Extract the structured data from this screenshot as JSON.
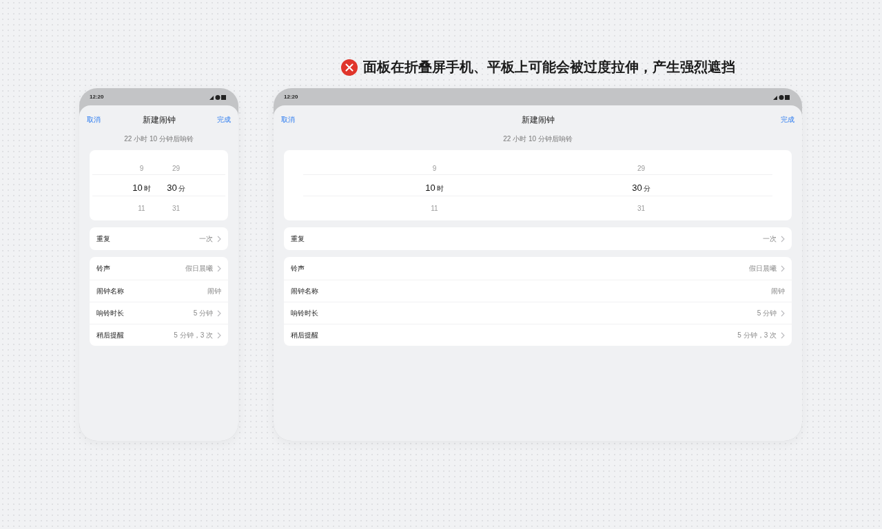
{
  "caption": {
    "text": "面板在折叠屏手机、平板上可能会被过度拉伸，产生强烈遮挡",
    "kind": "error"
  },
  "devices": [
    {
      "kind": "phone",
      "status_bar": {
        "time": "12:20"
      },
      "nav": {
        "cancel": "取消",
        "title": "新建闹钟",
        "done": "完成"
      },
      "countdown": "22 小时 10 分钟后响铃",
      "picker": [
        {
          "unit": "时",
          "items": [
            {
              "text": "9",
              "selected": false
            },
            {
              "text": "10",
              "selected": true
            },
            {
              "text": "11",
              "selected": false
            }
          ]
        },
        {
          "unit": "分",
          "items": [
            {
              "text": "29",
              "selected": false
            },
            {
              "text": "30",
              "selected": true
            },
            {
              "text": "31",
              "selected": false
            }
          ]
        }
      ],
      "groups": [
        [
          {
            "label": "重复",
            "value": "一次",
            "chevron": true
          }
        ],
        [
          {
            "label": "铃声",
            "value": "假日晨曦",
            "chevron": true
          },
          {
            "label": "闹钟名称",
            "value": "闹钟",
            "chevron": false
          },
          {
            "label": "响铃时长",
            "value": "5 分钟",
            "chevron": true
          },
          {
            "label": "稍后提醒",
            "value": "5 分钟，3 次",
            "chevron": true
          }
        ]
      ]
    },
    {
      "kind": "tablet",
      "status_bar": {
        "time": "12:20"
      },
      "nav": {
        "cancel": "取消",
        "title": "新建闹钟",
        "done": "完成"
      },
      "countdown": "22 小时 10 分钟后响铃",
      "picker": [
        {
          "unit": "时",
          "items": [
            {
              "text": "9",
              "selected": false
            },
            {
              "text": "10",
              "selected": true
            },
            {
              "text": "11",
              "selected": false
            }
          ]
        },
        {
          "unit": "分",
          "items": [
            {
              "text": "29",
              "selected": false
            },
            {
              "text": "30",
              "selected": true
            },
            {
              "text": "31",
              "selected": false
            }
          ]
        }
      ],
      "groups": [
        [
          {
            "label": "重复",
            "value": "一次",
            "chevron": true
          }
        ],
        [
          {
            "label": "铃声",
            "value": "假日晨曦",
            "chevron": true
          },
          {
            "label": "闹钟名称",
            "value": "闹钟",
            "chevron": false
          },
          {
            "label": "响铃时长",
            "value": "5 分钟",
            "chevron": true
          },
          {
            "label": "稍后提醒",
            "value": "5 分钟，3 次",
            "chevron": true
          }
        ]
      ]
    }
  ]
}
